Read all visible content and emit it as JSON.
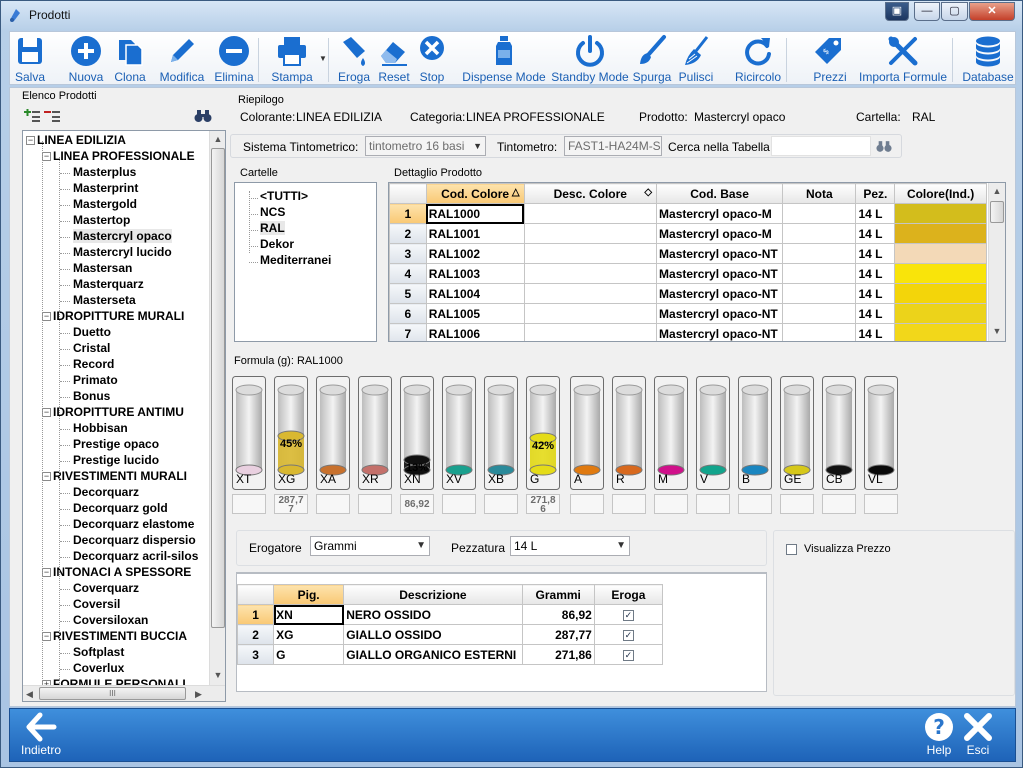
{
  "window": {
    "title": "Prodotti",
    "btn_restore": "▣",
    "btn_min": "—",
    "btn_max": "▢",
    "btn_close": "✕"
  },
  "toolbar": {
    "items": [
      {
        "label": "Salva",
        "icon": "save-icon"
      },
      {
        "label": "Nuova",
        "icon": "plus-circle-icon"
      },
      {
        "label": "Clona",
        "icon": "copy-icon"
      },
      {
        "label": "Modifica",
        "icon": "pencil-icon"
      },
      {
        "label": "Elimina",
        "icon": "minus-circle-icon"
      },
      {
        "label": "Stampa",
        "icon": "printer-icon"
      },
      {
        "label": "Eroga",
        "icon": "dispense-icon"
      },
      {
        "label": "Reset",
        "icon": "eraser-icon"
      },
      {
        "label": "Stop",
        "icon": "stop-icon"
      },
      {
        "label": "Dispense Mode",
        "icon": "bottle-icon"
      },
      {
        "label": "Standby Mode",
        "icon": "power-icon"
      },
      {
        "label": "Spurga",
        "icon": "brush-icon"
      },
      {
        "label": "Pulisci",
        "icon": "broom-icon"
      },
      {
        "label": "Ricircolo",
        "icon": "refresh-icon"
      },
      {
        "label": "Prezzi",
        "icon": "price-tag-icon"
      },
      {
        "label": "Importa Formule",
        "icon": "tools-icon"
      },
      {
        "label": "Database",
        "icon": "database-icon"
      }
    ]
  },
  "left_panel": {
    "title": "Elenco Prodotti",
    "tree": [
      {
        "label": "LINEA EDILIZIA",
        "level": 0,
        "expander": "−"
      },
      {
        "label": "LINEA PROFESSIONALE",
        "level": 1,
        "expander": "−"
      },
      {
        "label": "Masterplus",
        "level": 2
      },
      {
        "label": "Masterprint",
        "level": 2
      },
      {
        "label": "Mastergold",
        "level": 2
      },
      {
        "label": "Mastertop",
        "level": 2
      },
      {
        "label": "Mastercryl opaco",
        "level": 2,
        "selected": true
      },
      {
        "label": "Mastercryl lucido",
        "level": 2
      },
      {
        "label": "Mastersan",
        "level": 2
      },
      {
        "label": "Masterquarz",
        "level": 2
      },
      {
        "label": "Masterseta",
        "level": 2
      },
      {
        "label": "IDROPITTURE MURALI",
        "level": 1,
        "expander": "−"
      },
      {
        "label": "Duetto",
        "level": 2
      },
      {
        "label": "Cristal",
        "level": 2
      },
      {
        "label": "Record",
        "level": 2
      },
      {
        "label": "Primato",
        "level": 2
      },
      {
        "label": "Bonus",
        "level": 2
      },
      {
        "label": "IDROPITTURE ANTIMU",
        "level": 1,
        "expander": "−"
      },
      {
        "label": "Hobbisan",
        "level": 2
      },
      {
        "label": "Prestige opaco",
        "level": 2
      },
      {
        "label": "Prestige lucido",
        "level": 2
      },
      {
        "label": "RIVESTIMENTI MURALI",
        "level": 1,
        "expander": "−"
      },
      {
        "label": "Decorquarz",
        "level": 2
      },
      {
        "label": "Decorquarz gold",
        "level": 2
      },
      {
        "label": "Decorquarz elastome",
        "level": 2
      },
      {
        "label": "Decorquarz dispersio",
        "level": 2
      },
      {
        "label": "Decorquarz acril-silos",
        "level": 2
      },
      {
        "label": "INTONACI A SPESSORE",
        "level": 1,
        "expander": "−"
      },
      {
        "label": "Coverquarz",
        "level": 2
      },
      {
        "label": "Coversil",
        "level": 2
      },
      {
        "label": "Coversiloxan",
        "level": 2
      },
      {
        "label": "RIVESTIMENTI BUCCIA",
        "level": 1,
        "expander": "−"
      },
      {
        "label": "Softplast",
        "level": 2
      },
      {
        "label": "Coverlux",
        "level": 2
      },
      {
        "label": "FORMULE PERSONALI",
        "level": 1,
        "expander": "+"
      }
    ],
    "hscroll_thumb": "III"
  },
  "riepilogo": {
    "title": "Riepilogo",
    "colorante_label": "Colorante:",
    "colorante_value": "LINEA EDILIZIA",
    "categoria_label": "Categoria:",
    "categoria_value": "LINEA PROFESSIONALE",
    "prodotto_label": "Prodotto:",
    "prodotto_value": "Mastercryl opaco",
    "cartella_label": "Cartella:",
    "cartella_value": "RAL"
  },
  "sistema": {
    "label": "Sistema Tintometrico:",
    "value": "tintometro 16 basi",
    "tintometro_label": "Tintometro:",
    "tintometro_value": "FAST1-HA24M-S",
    "cerca_label": "Cerca nella Tabella",
    "cerca_value": ""
  },
  "cartelle": {
    "title": "Cartelle",
    "items": [
      "<TUTTI>",
      "NCS",
      "RAL",
      "Dekor",
      "Mediterranei"
    ],
    "selected": "RAL"
  },
  "dettaglio": {
    "title": "Dettaglio Prodotto",
    "columns": [
      "Cod. Colore",
      "Desc. Colore",
      "Cod. Base",
      "Nota",
      "Pez.",
      "Colore(Ind.)"
    ],
    "sort_indicators": [
      "△",
      "◇"
    ],
    "rows": [
      {
        "n": "1",
        "cod": "RAL1000",
        "desc": "",
        "base": "Mastercryl opaco-M",
        "nota": "",
        "pez": "14 L",
        "color": "#d3bd1c"
      },
      {
        "n": "2",
        "cod": "RAL1001",
        "desc": "",
        "base": "Mastercryl opaco-M",
        "nota": "",
        "pez": "14 L",
        "color": "#dcb21c"
      },
      {
        "n": "3",
        "cod": "RAL1002",
        "desc": "",
        "base": "Mastercryl opaco-NT",
        "nota": "",
        "pez": "14 L",
        "color": "#f3d9b7"
      },
      {
        "n": "4",
        "cod": "RAL1003",
        "desc": "",
        "base": "Mastercryl opaco-NT",
        "nota": "",
        "pez": "14 L",
        "color": "#f9e40a"
      },
      {
        "n": "5",
        "cod": "RAL1004",
        "desc": "",
        "base": "Mastercryl opaco-NT",
        "nota": "",
        "pez": "14 L",
        "color": "#f3d50a"
      },
      {
        "n": "6",
        "cod": "RAL1005",
        "desc": "",
        "base": "Mastercryl opaco-NT",
        "nota": "",
        "pez": "14 L",
        "color": "#ecd31a"
      },
      {
        "n": "7",
        "cod": "RAL1006",
        "desc": "",
        "base": "Mastercryl opaco-NT",
        "nota": "",
        "pez": "14 L",
        "color": "#f2d71a"
      }
    ]
  },
  "formula": {
    "title": "Formula (g): RAL1000",
    "canisters": [
      {
        "name": "XT",
        "color": "#e9d0e0",
        "fill_pct": 0,
        "pct_label": "",
        "value": ""
      },
      {
        "name": "XG",
        "color": "#d9b830",
        "fill_pct": 45,
        "pct_label": "45%",
        "value": "287,7\n7"
      },
      {
        "name": "XA",
        "color": "#c8712d",
        "fill_pct": 0,
        "pct_label": "",
        "value": ""
      },
      {
        "name": "XR",
        "color": "#c4706a",
        "fill_pct": 0,
        "pct_label": "",
        "value": ""
      },
      {
        "name": "XN",
        "color": "#101010",
        "fill_pct": 13,
        "pct_label": "13%",
        "value": "86,92"
      },
      {
        "name": "XV",
        "color": "#1aa08e",
        "fill_pct": 0,
        "pct_label": "",
        "value": ""
      },
      {
        "name": "XB",
        "color": "#2a8a9a",
        "fill_pct": 0,
        "pct_label": "",
        "value": ""
      },
      {
        "name": "G",
        "color": "#e5dc18",
        "fill_pct": 42,
        "pct_label": "42%",
        "value": "271,8\n6"
      },
      {
        "name": "A",
        "color": "#e07a10",
        "fill_pct": 0,
        "pct_label": "",
        "value": ""
      },
      {
        "name": "R",
        "color": "#d8691e",
        "fill_pct": 0,
        "pct_label": "",
        "value": ""
      },
      {
        "name": "M",
        "color": "#d0108a",
        "fill_pct": 0,
        "pct_label": "",
        "value": ""
      },
      {
        "name": "V",
        "color": "#12a48c",
        "fill_pct": 0,
        "pct_label": "",
        "value": ""
      },
      {
        "name": "B",
        "color": "#1a86c0",
        "fill_pct": 0,
        "pct_label": "",
        "value": ""
      },
      {
        "name": "GE",
        "color": "#d6c81a",
        "fill_pct": 0,
        "pct_label": "",
        "value": ""
      },
      {
        "name": "CB",
        "color": "#111111",
        "fill_pct": 0,
        "pct_label": "",
        "value": ""
      },
      {
        "name": "VL",
        "color": "#0a0a0a",
        "fill_pct": 0,
        "pct_label": "",
        "value": ""
      }
    ]
  },
  "erogatore": {
    "label": "Erogatore",
    "value": "Grammi",
    "pezzatura_label": "Pezzatura",
    "pezzatura_value": "14 L"
  },
  "pigmenti": {
    "columns": [
      "Pig.",
      "Descrizione",
      "Grammi",
      "Eroga"
    ],
    "rows": [
      {
        "n": "1",
        "pig": "XN",
        "desc": "NERO OSSIDO",
        "grammi": "86,92",
        "eroga": true
      },
      {
        "n": "2",
        "pig": "XG",
        "desc": "GIALLO OSSIDO",
        "grammi": "287,77",
        "eroga": true
      },
      {
        "n": "3",
        "pig": "G",
        "desc": "GIALLO ORGANICO ESTERNI",
        "grammi": "271,86",
        "eroga": true
      }
    ]
  },
  "visualizza_prezzo": {
    "label": "Visualizza Prezzo",
    "checked": false
  },
  "bottom": {
    "back_label": "Indietro",
    "help_label": "Help",
    "exit_label": "Esci"
  },
  "colors": {
    "accent": "#1a5fb4",
    "selection": "#f9c874",
    "bottom_bar": "#2a76cc"
  }
}
